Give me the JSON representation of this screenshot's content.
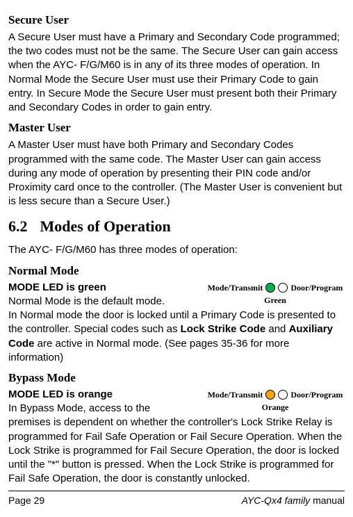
{
  "secureUser": {
    "heading": "Secure User",
    "body": "A Secure User must have a Primary and Secondary Code programmed; the two codes must not be the same. The Secure User can gain access when the AYC- F/G/M60 is in any of its three modes of operation. In Normal Mode the Secure User must use their Primary Code to gain entry. In Secure Mode the Secure User must present both their Primary and Secondary Codes in order to gain entry."
  },
  "masterUser": {
    "heading": "Master User",
    "body": "A Master User must have both Primary and Secondary Codes programmed with the same code. The Master User can gain access during any mode of operation by presenting their PIN code and/or Proximity card once to the controller. (The Master User is convenient but is less secure than a Secure User.)"
  },
  "section": {
    "num": "6.2",
    "title": "Modes of Operation",
    "intro": "The AYC- F/G/M60 has three modes of operation:"
  },
  "normalMode": {
    "heading": "Normal Mode",
    "ledLine": "MODE LED is green",
    "line1": "Normal Mode is the default mode.",
    "body_pre": "In Normal mode the door is locked until a Primary Code is presented to the controller. Special codes such as ",
    "bold1": "Lock Strike Code",
    "mid": " and ",
    "bold2": "Auxiliary Code",
    "body_post": " are active in Normal mode. (See pages 35-36 for more information)",
    "indicator": {
      "left": "Mode/Transmit",
      "right": "Door/Program",
      "color": "Green"
    }
  },
  "bypassMode": {
    "heading": "Bypass Mode",
    "ledLine": "MODE LED is orange",
    "line1": "In Bypass Mode, access to the",
    "body": "premises is dependent on whether the controller's Lock Strike Relay is programmed for Fail Safe Operation or Fail Secure Operation. When the Lock Strike is programmed for Fail Secure Operation, the door is locked until the \"*\" button is pressed. When the Lock Strike is programmed for Fail Safe Operation, the door is constantly unlocked.",
    "indicator": {
      "left": "Mode/Transmit",
      "right": "Door/Program",
      "color": "Orange"
    }
  },
  "footer": {
    "page": "Page 29",
    "product": "AYC-Qx4 family",
    "suffix": " manual"
  }
}
